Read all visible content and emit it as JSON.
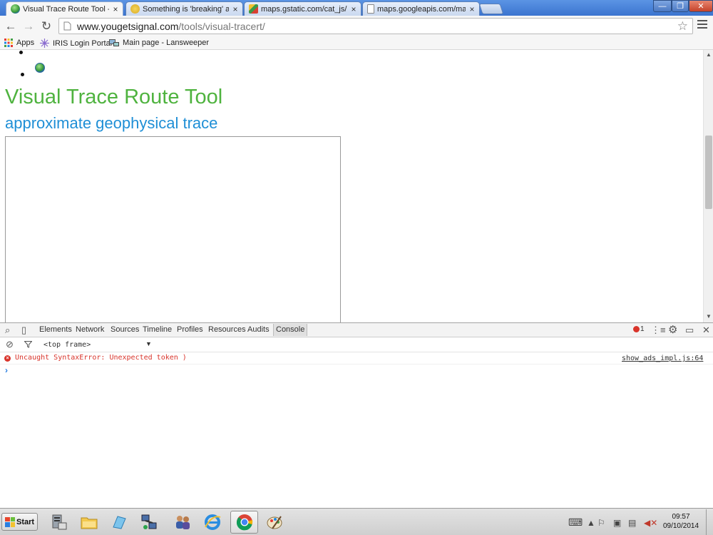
{
  "browser": {
    "tabs": [
      {
        "label": "Visual Trace Route Tool - Fin",
        "close": "×",
        "active": true
      },
      {
        "label": "Something is 'breaking' a wel",
        "close": "×",
        "active": false
      },
      {
        "label": "maps.gstatic.com/cat_js/map",
        "close": "×",
        "active": false
      },
      {
        "label": "maps.googleapis.com/maps/",
        "close": "×",
        "active": false
      }
    ],
    "window_controls": {
      "minimize": "—",
      "restore": "❐",
      "close": "✕"
    },
    "url": {
      "host": "www.yougetsignal.com",
      "path": "/tools/visual-tracert/"
    },
    "bookmarks": [
      {
        "label": "Apps",
        "icon": "apps-grid-icon"
      },
      {
        "label": "IRIS Login Portal",
        "icon": "iris-icon"
      },
      {
        "label": "Main page - Lansweeper",
        "icon": "lansweeper-icon"
      }
    ]
  },
  "page": {
    "title": "Visual Trace Route Tool",
    "subtitle": "approximate geophysical trace",
    "title_color": "#4fb33f",
    "subtitle_color": "#1f8fd6"
  },
  "devtools": {
    "tabs": [
      "Elements",
      "Network",
      "Sources",
      "Timeline",
      "Profiles",
      "Resources",
      "Audits",
      "Console"
    ],
    "active_tab": "Console",
    "error_count": "1",
    "context": "<top frame>",
    "messages": [
      {
        "level": "error",
        "text": "Uncaught SyntaxError: Unexpected token )",
        "source": "show_ads_impl.js:64"
      }
    ],
    "prompt": "›"
  },
  "taskbar": {
    "start_label": "Start",
    "apps": [
      "server-manager-icon",
      "file-explorer-icon",
      "blue-shape-icon",
      "network-icon",
      "users-icon",
      "internet-explorer-icon",
      "chrome-icon",
      "paint-icon"
    ],
    "active_app": "chrome-icon",
    "clock": {
      "time": "09:57",
      "date": "09/10/2014"
    }
  }
}
